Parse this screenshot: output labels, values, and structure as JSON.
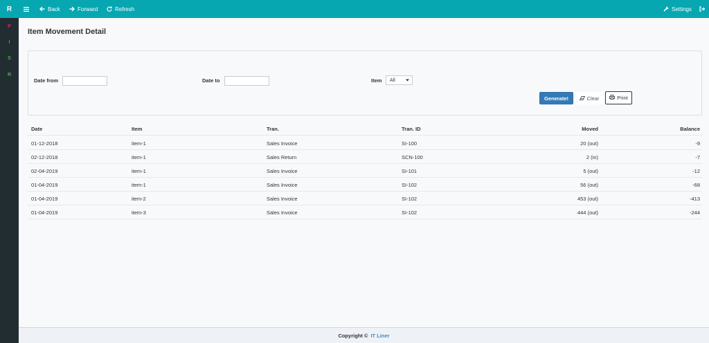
{
  "topbar": {
    "brand": "R",
    "back_label": "Back",
    "forward_label": "Forward",
    "refresh_label": "Refresh",
    "settings_label": "Settings",
    "color": "#06a7b1",
    "icons": {
      "menu": "hamburger-icon",
      "back": "arrow-left-icon",
      "forward": "arrow-right-icon",
      "refresh": "refresh-icon",
      "settings": "wrench-icon",
      "logout": "sign-out-icon"
    }
  },
  "sidebar": {
    "items": [
      {
        "label": "P",
        "color": "#e91e63"
      },
      {
        "label": "I",
        "color": "#03a9f4"
      },
      {
        "label": "S",
        "color": "#4caf50"
      },
      {
        "label": "R",
        "color": "#4caf50"
      }
    ]
  },
  "page": {
    "title": "Item Movement Detail"
  },
  "filters": {
    "date_from_label": "Date from",
    "date_from_value": "",
    "date_to_label": "Date to",
    "date_to_value": "",
    "item_label": "Item",
    "item_selected": "All",
    "generate_label": "Generate!",
    "clear_label": "Clear",
    "print_label": "Print"
  },
  "table": {
    "headers": {
      "date": "Date",
      "item": "Item",
      "tran": "Tran.",
      "tran_id": "Tran. ID",
      "moved": "Moved",
      "balance": "Balance"
    },
    "rows": [
      {
        "date": "01-12-2018",
        "item": "item-1",
        "tran": "Sales Invoice",
        "tran_id": "SI-100",
        "moved": "20 (out)",
        "balance": "-9"
      },
      {
        "date": "02-12-2018",
        "item": "item-1",
        "tran": "Sales Return",
        "tran_id": "SCN-100",
        "moved": "2 (in)",
        "balance": "-7"
      },
      {
        "date": "02-04-2019",
        "item": "item-1",
        "tran": "Sales Invoice",
        "tran_id": "SI-101",
        "moved": "5 (out)",
        "balance": "-12"
      },
      {
        "date": "01-04-2019",
        "item": "item-1",
        "tran": "Sales Invoice",
        "tran_id": "SI-102",
        "moved": "56 (out)",
        "balance": "-68"
      },
      {
        "date": "01-04-2019",
        "item": "item-2",
        "tran": "Sales Invoice",
        "tran_id": "SI-102",
        "moved": "453 (out)",
        "balance": "-413"
      },
      {
        "date": "01-04-2019",
        "item": "item-3",
        "tran": "Sales Invoice",
        "tran_id": "SI-102",
        "moved": "444 (out)",
        "balance": "-244"
      }
    ]
  },
  "footer": {
    "copyright": "Copyright ©",
    "company": "IT Liner"
  },
  "colors": {
    "accent": "#06a7b1",
    "primary_button": "#337ab7",
    "sidebar_bg": "#222d32",
    "link": "#3c8dbc"
  }
}
